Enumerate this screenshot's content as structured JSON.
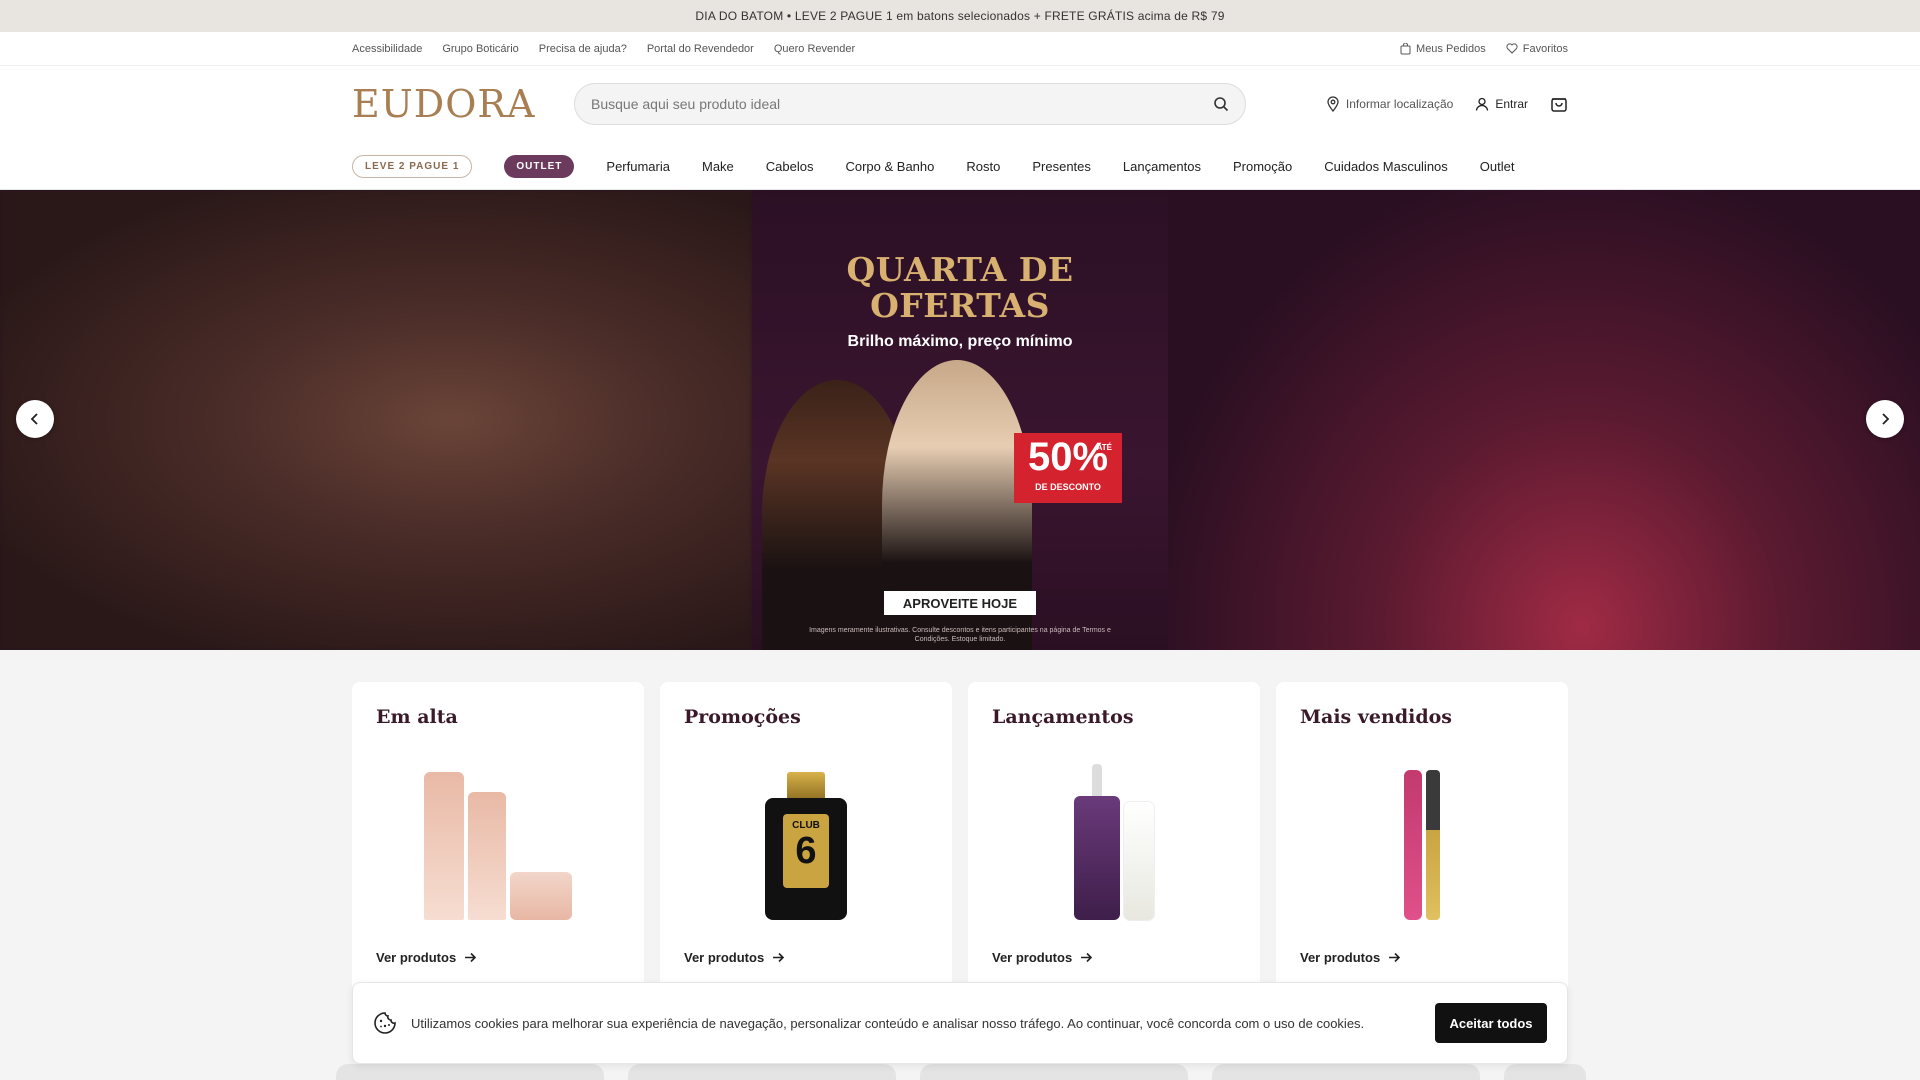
{
  "promo_bar": {
    "text": "DIA DO BATOM • LEVE 2 PAGUE 1 em batons selecionados + FRETE GRÁTIS acima de R$ 79"
  },
  "util_bar": {
    "links": [
      "Acessibilidade",
      "Grupo Boticário",
      "Precisa de ajuda?",
      "Portal do Revendedor",
      "Quero Revender"
    ],
    "orders": "Meus Pedidos",
    "favorites": "Favoritos"
  },
  "header": {
    "logo": "EUDORA",
    "search_placeholder": "Busque aqui seu produto ideal",
    "location": "Informar localização",
    "login": "Entrar"
  },
  "nav": {
    "pill_outline": "LEVE 2 PAGUE 1",
    "pill_filled": "OUTLET",
    "items": [
      "Perfumaria",
      "Make",
      "Cabelos",
      "Corpo & Banho",
      "Rosto",
      "Presentes",
      "Lançamentos",
      "Promoção",
      "Cuidados Masculinos",
      "Outlet"
    ]
  },
  "hero": {
    "title": "QUARTA DE OFERTAS",
    "subtitle": "Brilho máximo, preço mínimo",
    "badge_num": "50%",
    "badge_prefix": "ATÉ",
    "badge_sub": "DE DESCONTO",
    "cta": "APROVEITE HOJE",
    "disclaimer": "Imagens meramente ilustrativas. Consulte descontos e itens participantes na página de Termos e Condições. Estoque limitado."
  },
  "cards": [
    {
      "title": "Em alta",
      "link": "Ver produtos"
    },
    {
      "title": "Promoções",
      "link": "Ver produtos"
    },
    {
      "title": "Lançamentos",
      "link": "Ver produtos"
    },
    {
      "title": "Mais vendidos",
      "link": "Ver produtos"
    }
  ],
  "products": {
    "club6_label": "CLUB",
    "club6_num": "6"
  },
  "cookie": {
    "text": "Utilizamos cookies para melhorar sua experiência de navegação, personalizar conteúdo e analisar nosso tráfego. Ao continuar, você concorda com o uso de cookies.",
    "button": "Aceitar todos"
  },
  "colors": {
    "brand_gold": "#a87e52",
    "outlet_pill": "#6b3a5c",
    "hero_title": "#d8b070",
    "badge_red": "#d4222e"
  }
}
